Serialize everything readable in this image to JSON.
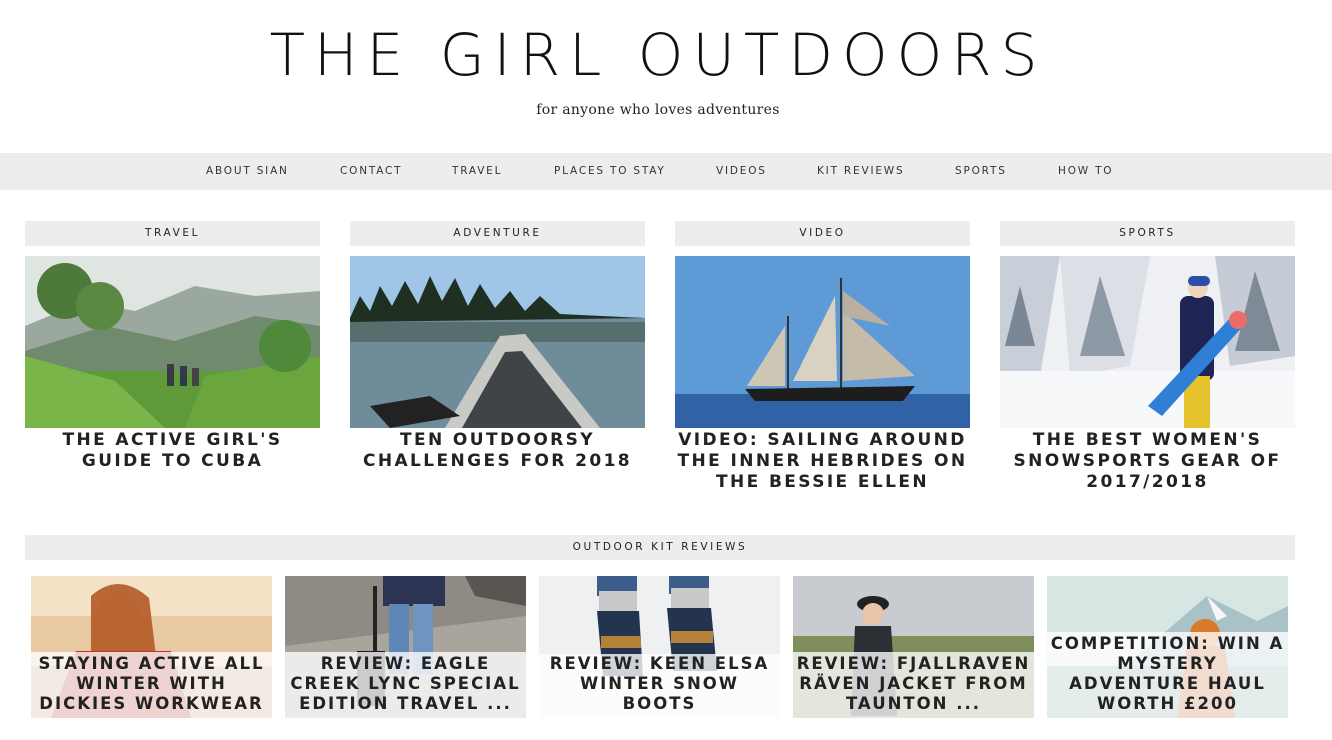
{
  "site": {
    "title": "THE GIRL OUTDOORS",
    "tagline": "for anyone who loves adventures"
  },
  "nav": [
    {
      "label": "ABOUT SIAN"
    },
    {
      "label": "CONTACT"
    },
    {
      "label": "TRAVEL"
    },
    {
      "label": "PLACES TO STAY"
    },
    {
      "label": "VIDEOS"
    },
    {
      "label": "KIT REVIEWS"
    },
    {
      "label": "SPORTS"
    },
    {
      "label": "HOW TO"
    }
  ],
  "featured": [
    {
      "category": "TRAVEL",
      "title": "THE ACTIVE GIRL'S GUIDE TO CUBA",
      "image": "hikers-in-green-valley"
    },
    {
      "category": "ADVENTURE",
      "title": "TEN OUTDOORSY CHALLENGES FOR 2018",
      "image": "canoe-on-lake"
    },
    {
      "category": "VIDEO",
      "title": "VIDEO: SAILING AROUND THE INNER HEBRIDES ON THE BESSIE ELLEN",
      "image": "tall-ship-at-sea"
    },
    {
      "category": "SPORTS",
      "title": "THE BEST WOMEN'S SNOWSPORTS GEAR OF 2017/2018",
      "image": "snowboarder-in-snowy-forest"
    }
  ],
  "kit_section": {
    "label": "OUTDOOR KIT REVIEWS",
    "items": [
      {
        "title": "STAYING ACTIVE ALL WINTER WITH DICKIES WORKWEAR",
        "image": "woman-at-beach-sunset"
      },
      {
        "title": "REVIEW: EAGLE CREEK LYNC SPECIAL EDITION TRAVEL ...",
        "image": "rolling-suitcase-on-pavement"
      },
      {
        "title": "REVIEW: KEEN ELSA WINTER SNOW BOOTS",
        "image": "boots-in-snow"
      },
      {
        "title": "REVIEW: FJALLRAVEN RÄVEN JACKET FROM TAUNTON ...",
        "image": "woman-in-jacket-outdoors"
      },
      {
        "title": "COMPETITION: WIN A MYSTERY ADVENTURE HAUL WORTH £200",
        "image": "person-with-mountain-view"
      }
    ]
  }
}
